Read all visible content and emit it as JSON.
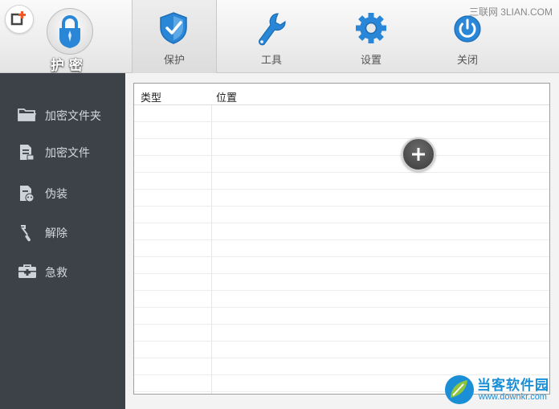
{
  "header": {
    "logo_text": "护密",
    "tabs": [
      {
        "label": "保护",
        "icon": "shield-icon",
        "active": true
      },
      {
        "label": "工具",
        "icon": "wrench-icon",
        "active": false
      },
      {
        "label": "设置",
        "icon": "gear-icon",
        "active": false
      },
      {
        "label": "关闭",
        "icon": "power-icon",
        "active": false
      }
    ],
    "watermark": "三联网 3LIAN.COM"
  },
  "sidebar": {
    "items": [
      {
        "label": "加密文件夹",
        "icon": "folder-icon"
      },
      {
        "label": "加密文件",
        "icon": "file-icon"
      },
      {
        "label": "伪装",
        "icon": "disguise-icon"
      },
      {
        "label": "解除",
        "icon": "unlock-icon"
      },
      {
        "label": "急救",
        "icon": "first-aid-icon"
      }
    ]
  },
  "table": {
    "columns": [
      "类型",
      "位置"
    ],
    "rows": []
  },
  "watermark_bottom": {
    "name": "当客软件园",
    "url": "www.downkr.com"
  },
  "colors": {
    "sidebar_bg": "#3d4248",
    "accent_blue": "#2a86d6",
    "watermark_blue": "#1a8fd6"
  }
}
